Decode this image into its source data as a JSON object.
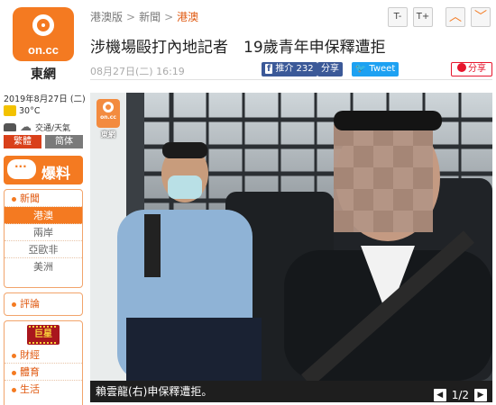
{
  "site": {
    "logo_text": "on.cc",
    "name": "東網"
  },
  "sidebar": {
    "date": "2019年8月27日 (二)",
    "temperature": "30°C",
    "traffic_label": "交通/天氣",
    "lang_trad": "繁體",
    "lang_simp": "简体",
    "baoliao": "爆料",
    "news_label": "新聞",
    "news_items": [
      "港澳",
      "兩岸",
      "亞歐非",
      "美洲"
    ],
    "active_news_item": "港澳",
    "comment_label": "評論",
    "star_logo": "巨星",
    "more_items": [
      "財經",
      "體育",
      "生活"
    ]
  },
  "breadcrumb": {
    "items": [
      "港澳版",
      "新聞"
    ],
    "current": "港澳"
  },
  "toolbar": {
    "font_smaller": "T-",
    "font_larger": "T+"
  },
  "article": {
    "title": "涉機場毆打內地記者　19歲青年申保釋遭拒",
    "published": "08月27日(二) 16:19",
    "fb_like_label": "推介 232",
    "fb_share_label": "分享",
    "tweet_label": "Tweet",
    "weibo_label": "分享"
  },
  "photo": {
    "watermark_text": "on.cc",
    "watermark_name": "東網",
    "caption": "賴雲龍(右)申保釋遭拒。",
    "counter": "1/2"
  },
  "colors": {
    "brand": "#f47a21",
    "facebook": "#3b5998",
    "twitter": "#1da1f2",
    "weibo": "#e6162d"
  }
}
